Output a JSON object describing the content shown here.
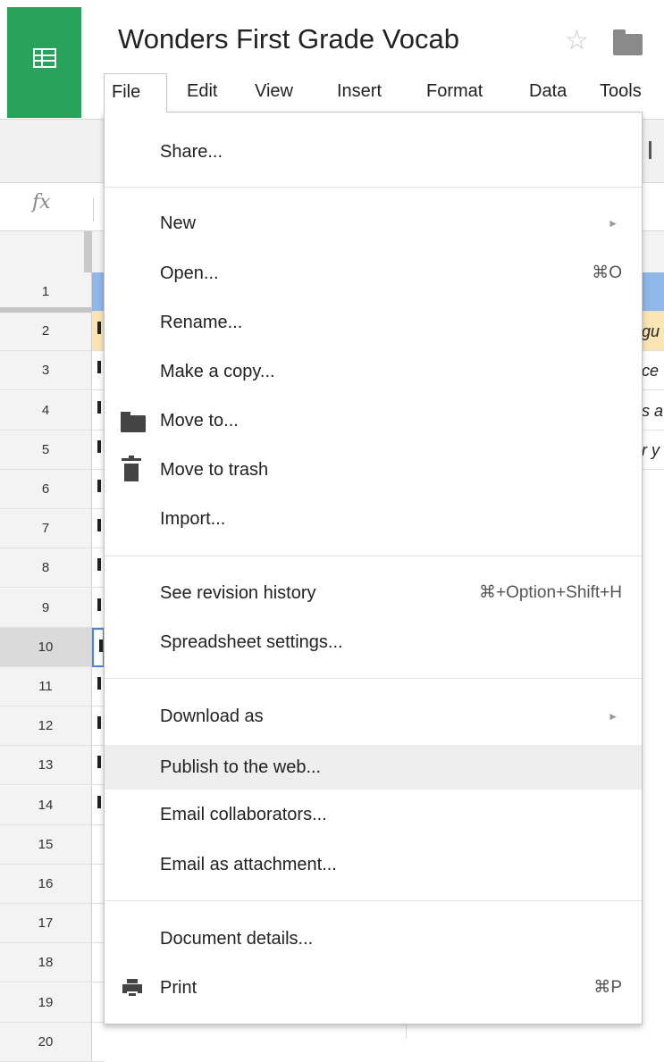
{
  "app": {
    "icon": "sheets-logo-icon",
    "brand_color": "#27a35c"
  },
  "doc": {
    "title": "Wonders First Grade Vocab"
  },
  "menubar": [
    "File",
    "Edit",
    "View",
    "Insert",
    "Format",
    "Data",
    "Tools"
  ],
  "formula": {
    "fx_label": "fx"
  },
  "rows": [
    "1",
    "2",
    "3",
    "4",
    "5",
    "6",
    "7",
    "8",
    "9",
    "10",
    "11",
    "12",
    "13",
    "14",
    "15",
    "16",
    "17",
    "18",
    "19",
    "20"
  ],
  "right_cells": [
    "",
    "gu",
    "ce",
    "s a",
    "r y"
  ],
  "file_menu": {
    "share": "Share...",
    "new": "New",
    "open": "Open...",
    "open_shortcut": "⌘O",
    "rename": "Rename...",
    "make_copy": "Make a copy...",
    "move_to": "Move to...",
    "move_to_trash": "Move to trash",
    "import": "Import...",
    "revision_history": "See revision history",
    "revision_shortcut": "⌘+Option+Shift+H",
    "spreadsheet_settings": "Spreadsheet settings...",
    "download_as": "Download as",
    "publish": "Publish to the web...",
    "email_collaborators": "Email collaborators...",
    "email_attachment": "Email as attachment...",
    "document_details": "Document details...",
    "print": "Print",
    "print_shortcut": "⌘P",
    "submenu_arrow": "►"
  }
}
